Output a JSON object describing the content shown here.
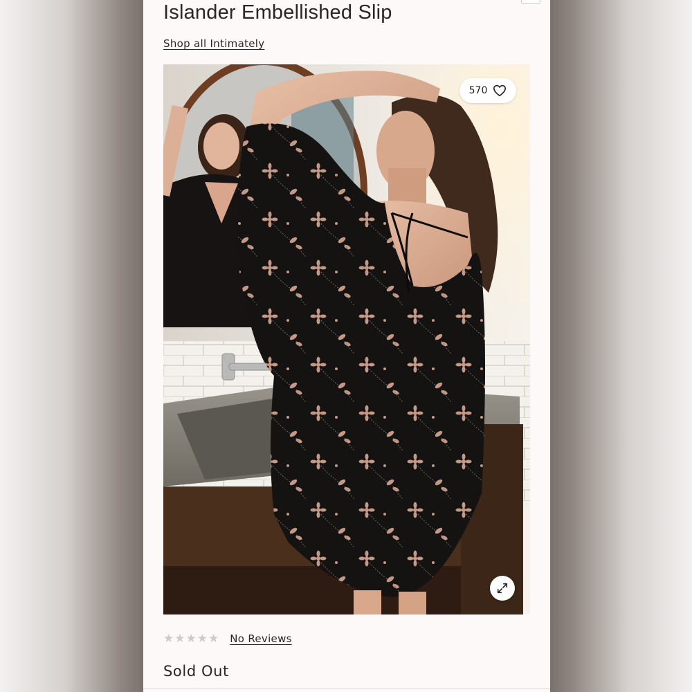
{
  "product": {
    "title": "Islander Embellished Slip",
    "shop_link": "Shop all Intimately"
  },
  "image": {
    "like_count": "570",
    "like_icon": "heart-icon",
    "expand_icon": "expand-arrows-icon"
  },
  "reviews": {
    "rating_stars": 0,
    "max_stars": 5,
    "label": "No Reviews"
  },
  "availability": {
    "status": "Sold Out"
  },
  "colors": {
    "card_background": "#fcf9f8",
    "text": "#2b2624",
    "star_empty": "#cfcac7"
  }
}
